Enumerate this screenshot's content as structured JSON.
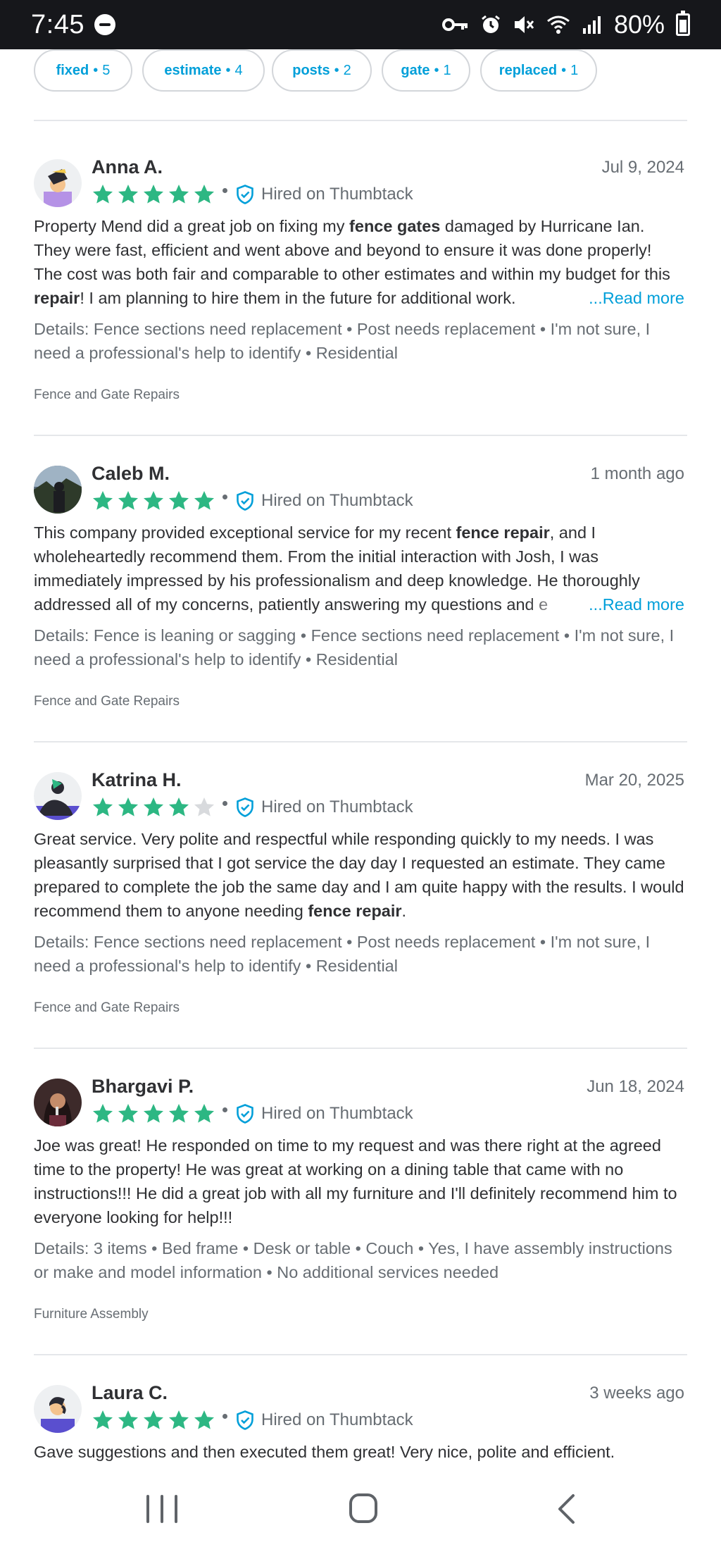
{
  "status_bar": {
    "time": "7:45",
    "battery": "80%"
  },
  "filters": [
    {
      "label": "fixed",
      "count": "5"
    },
    {
      "label": "estimate",
      "count": "4"
    },
    {
      "label": "posts",
      "count": "2"
    },
    {
      "label": "gate",
      "count": "1"
    },
    {
      "label": "replaced",
      "count": "1"
    }
  ],
  "hired_label": "Hired on Thumbtack",
  "read_more": "...Read more",
  "colors": {
    "star": "#2db783",
    "accent": "#009fd9",
    "shield": "#009fd9"
  },
  "reviews": [
    {
      "name": "Anna A.",
      "date": "Jul 9, 2024",
      "rating": 5,
      "body_1": "Property Mend did a great job on fixing my ",
      "body_b1": "fence gates",
      "body_2": " damaged by Hurricane Ian. They were fast, efficient and went above and beyond to ensure it was done properly! The cost was both fair and comparable to other estimates and within my budget for this ",
      "body_b2": "repair",
      "body_3": "! I am planning to hire them in the future for additional work.",
      "details": "Details: Fence sections need replacement • Post needs replacement • I'm not sure, I need a professional's help to identify • Residential",
      "category": "Fence and Gate Repairs"
    },
    {
      "name": "Caleb M.",
      "date": "1 month ago",
      "rating": 5,
      "body_1": "This company provided exceptional service for my recent ",
      "body_b1": "fence repair",
      "body_2": ", and I wholeheartedly recommend them. From the initial interaction with Josh, I was immediately impressed by his professionalism and deep knowledge. He thoroughly addressed all of my concerns, patiently answering my questions and e",
      "details": "Details: Fence is leaning or sagging • Fence sections need replacement • I'm not sure, I need a professional's help to identify • Residential",
      "category": "Fence and Gate Repairs"
    },
    {
      "name": "Katrina H.",
      "date": "Mar 20, 2025",
      "rating": 4,
      "body_1": "Great service. Very polite and respectful while responding quickly to my needs. I was pleasantly surprised that I got service the day day I requested an estimate. They came prepared to complete the job the same day and I am quite happy with the results. I would recommend them to anyone needing ",
      "body_b1": "fence repair",
      "body_2": ".",
      "details": "Details: Fence sections need replacement • Post needs replacement • I'm not sure, I need a professional's help to identify • Residential",
      "category": "Fence and Gate Repairs"
    },
    {
      "name": "Bhargavi P.",
      "date": "Jun 18, 2024",
      "rating": 5,
      "body_1": "Joe was great! He responded on time to my request and was there right at the agreed time to the property! He was great at working on a dining table that came with no instructions!!! He did a great job with all my furniture and I'll definitely recommend him to everyone looking for help!!!",
      "details": "Details: 3 items • Bed frame • Desk or table • Couch • Yes, I have assembly instructions or make and model information • No additional services needed",
      "category": "Furniture Assembly"
    },
    {
      "name": "Laura C.",
      "date": "3 weeks ago",
      "rating": 5,
      "body_1": "Gave suggestions and then executed them great! Very nice, polite and efficient."
    }
  ]
}
